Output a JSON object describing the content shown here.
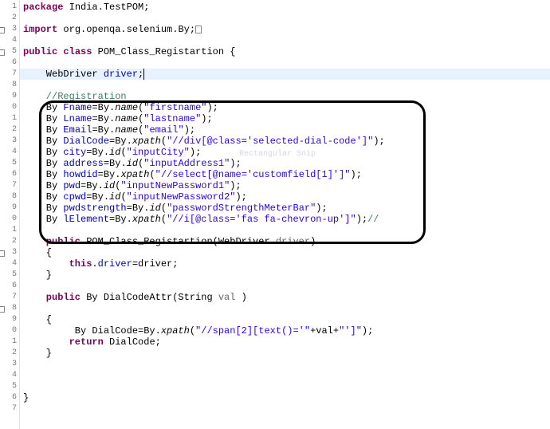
{
  "gutter": [
    "1",
    "2",
    "3",
    "4",
    "5",
    "6",
    "7",
    "8",
    "9",
    "0",
    "1",
    "2",
    "3",
    "4",
    "5",
    "6",
    "7",
    "8",
    "9",
    "0",
    "1",
    "2",
    "3",
    "4",
    "5",
    "6",
    "7",
    "8",
    "9",
    "0",
    "1",
    "2",
    "3",
    "4",
    "5",
    "6",
    "7"
  ],
  "expandable": [
    2,
    4,
    22,
    27
  ],
  "pkg": {
    "kw": "package",
    "name": " India.TestPOM;"
  },
  "imp": {
    "kw": "import",
    "name": " org.openqa.selenium.By;"
  },
  "cls": {
    "kw1": "public",
    "kw2": "class",
    "name": " POM_Class_Registartion {"
  },
  "fld": {
    "type": "    WebDriver ",
    "name": "driver",
    "semi": ";"
  },
  "comment": "    //Registration",
  "locators": [
    {
      "pre": "    By ",
      "var": "Fname",
      "eq": "=By.",
      "m": "name",
      "arg": "(\"firstname\");"
    },
    {
      "pre": "    By ",
      "var": "Lname",
      "eq": "=By.",
      "m": "name",
      "arg": "(\"lastname\");"
    },
    {
      "pre": "    By ",
      "var": "Email",
      "eq": "=By.",
      "m": "name",
      "arg": "(\"email\");"
    },
    {
      "pre": "    By ",
      "var": "DialCode",
      "eq": "=By.",
      "m": "xpath",
      "arg": "(\"//div[@class='selected-dial-code']\");"
    },
    {
      "pre": "    By ",
      "var": "city",
      "eq": "=By.",
      "m": "id",
      "arg": "(\"inputCity\");"
    },
    {
      "pre": "    By ",
      "var": "address",
      "eq": "=By.",
      "m": "id",
      "arg": "(\"inputAddress1\");"
    },
    {
      "pre": "    By ",
      "var": "howdid",
      "eq": "=By.",
      "m": "xpath",
      "arg": "(\"//select[@name='customfield[1]']\");"
    },
    {
      "pre": "    By ",
      "var": "pwd",
      "eq": "=By.",
      "m": "id",
      "arg": "(\"inputNewPassword1\");"
    },
    {
      "pre": "    By ",
      "var": "cpwd",
      "eq": "=By.",
      "m": "id",
      "arg": "(\"inputNewPassword2\");"
    },
    {
      "pre": "    By ",
      "var": "pwdstrength",
      "eq": "=By.",
      "m": "id",
      "arg": "(\"passwordStrengthMeterBar\");"
    },
    {
      "pre": "    By ",
      "var": "lElement",
      "eq": "=By.",
      "m": "xpath",
      "arg": "(\"//i[@class='fas fa-chevron-up']\");",
      "trail": "//"
    }
  ],
  "ctor": {
    "sig1": "    public",
    "sig2": " POM_Class_Registartion(WebDriver ",
    "p": "driver",
    "sig3": ")",
    "open": "    {",
    "body1": "        this",
    "body2": ".",
    "body3": "driver",
    "body4": "=driver;",
    "close": "    }"
  },
  "meth": {
    "sig1": "    public",
    "sig2": " By DialCodeAttr(String ",
    "p": "val",
    "sig3": " )",
    "open": "    {",
    "l1a": "         By DialCode=By.",
    "l1m": "xpath",
    "l1b": "(",
    "l1s1": "\"//span[2][text()='\"",
    "l1c": "+val+",
    "l1s2": "\"']\"",
    "l1d": ");",
    "ret": "        return",
    "ret2": " DialCode;",
    "close": "    }"
  },
  "closebrace": "}",
  "watermark": "Rectangular Snip"
}
